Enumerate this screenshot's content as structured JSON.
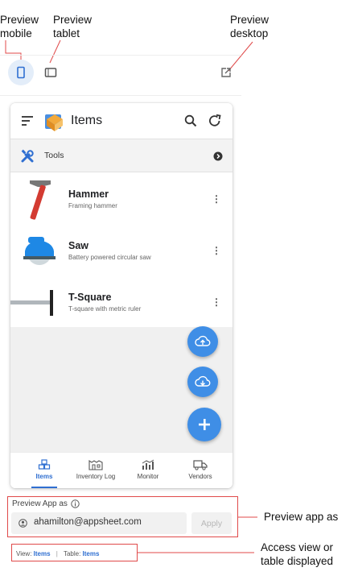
{
  "callouts": {
    "preview_mobile": "Preview\nmobile",
    "preview_tablet": "Preview\ntablet",
    "preview_desktop": "Preview\ndesktop",
    "preview_app_as": "Preview app as",
    "access_view": "Access view or\ntable displayed"
  },
  "app": {
    "title": "Items",
    "group": {
      "label": "Tools"
    },
    "items": [
      {
        "title": "Hammer",
        "subtitle": "Framing hammer"
      },
      {
        "title": "Saw",
        "subtitle": "Battery powered circular saw"
      },
      {
        "title": "T-Square",
        "subtitle": "T-square with metric ruler"
      }
    ],
    "more_glyph": "⋮",
    "nav": [
      {
        "label": "Items",
        "icon": "items-icon",
        "active": true
      },
      {
        "label": "Inventory Log",
        "icon": "inventory-log-icon",
        "active": false
      },
      {
        "label": "Monitor",
        "icon": "monitor-icon",
        "active": false
      },
      {
        "label": "Vendors",
        "icon": "vendors-icon",
        "active": false
      }
    ]
  },
  "preview_as": {
    "label": "Preview App as",
    "email": "ahamilton@appsheet.com",
    "apply": "Apply"
  },
  "context": {
    "view_label": "View:",
    "view_value": "Items",
    "separator": "|",
    "table_label": "Table:",
    "table_value": "Items"
  },
  "colors": {
    "accent": "#3f8ee6",
    "link": "#2f6fd1",
    "callout": "#e04a4a"
  }
}
